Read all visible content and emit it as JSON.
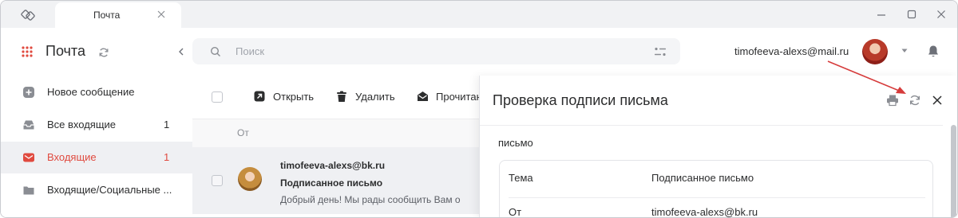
{
  "titlebar": {
    "tab_label": "Почта",
    "icons": [
      "app-logo-icon",
      "close-icon",
      "minimize-icon",
      "maximize-icon",
      "close-icon"
    ]
  },
  "sidebar": {
    "title": "Почта",
    "items": [
      {
        "label": "Новое сообщение",
        "count": "",
        "icon": "plus-icon"
      },
      {
        "label": "Все входящие",
        "count": "1",
        "icon": "inbox-icon"
      },
      {
        "label": "Входящие",
        "count": "1",
        "icon": "mail-icon"
      },
      {
        "label": "Входящие/Социальные ...",
        "count": "",
        "icon": "folder-icon"
      }
    ]
  },
  "search": {
    "placeholder": "Поиск"
  },
  "account": {
    "email": "timofeeva-alexs@mail.ru"
  },
  "toolbar": {
    "open_label": "Открыть",
    "delete_label": "Удалить",
    "read_label": "Прочитано"
  },
  "list": {
    "column_from": "От",
    "messages": [
      {
        "from": "timofeeva-alexs@bk.ru",
        "subject": "Подписанное письмо",
        "snippet": "Добрый день! Мы рады сообщить Вам о"
      }
    ]
  },
  "panel": {
    "title": "Проверка подписи письма",
    "subtitle": "письмо",
    "rows": [
      {
        "label": "Тема",
        "value": "Подписанное письмо"
      },
      {
        "label": "От",
        "value": "timofeeva-alexs@bk.ru"
      }
    ]
  },
  "colors": {
    "accent": "#e04a3f",
    "annotation_arrow": "#d63b3b",
    "selected_bg": "#eff0f3"
  }
}
